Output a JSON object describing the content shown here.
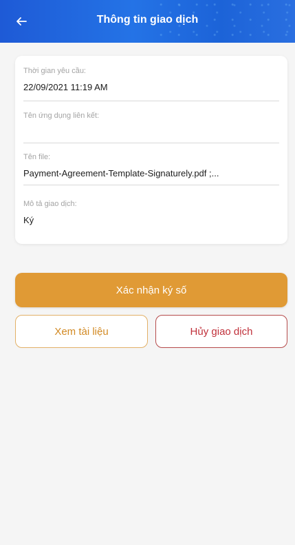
{
  "header": {
    "title": "Thông tin giao dịch",
    "back_icon": "arrow-left-icon",
    "colors": {
      "background": "#2473e6",
      "text": "#ffffff"
    }
  },
  "details": {
    "request_time": {
      "label": "Thời gian yêu cầu:",
      "value": "22/09/2021 11:19 AM"
    },
    "linked_app": {
      "label": "Tên ứng dụng liên kết:",
      "value": ""
    },
    "file_name": {
      "label": "Tên file:",
      "value": "Payment-Agreement-Template-Signaturely.pdf ;..."
    },
    "description": {
      "label": "Mô tả giao dịch:",
      "value": "Ký"
    }
  },
  "actions": {
    "confirm_label": "Xác nhận ký số",
    "view_label": "Xem tài liệu",
    "cancel_label": "Hủy giao dịch"
  },
  "colors": {
    "primary": "#e09a35",
    "view_border": "#e2b066",
    "cancel": "#c0303a",
    "background": "#f5f5f5"
  }
}
